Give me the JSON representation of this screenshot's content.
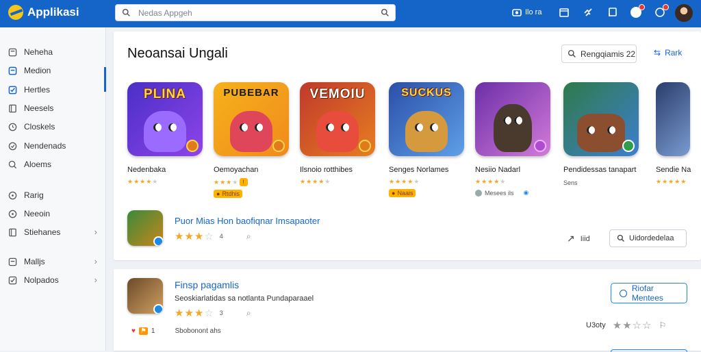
{
  "app": {
    "title": "Applikasi"
  },
  "search": {
    "placeholder": "Nedas Appgeh"
  },
  "topbar": {
    "notify_label": "Ilo ra"
  },
  "sidebar": {
    "items": [
      {
        "label": "Neheha",
        "icon": "box-icon"
      },
      {
        "label": "Medion",
        "icon": "image-icon"
      },
      {
        "label": "Hertles",
        "icon": "check-square-icon"
      },
      {
        "label": "Neesels",
        "icon": "book-icon"
      },
      {
        "label": "Closkels",
        "icon": "circle-clock-icon"
      },
      {
        "label": "Nendenads",
        "icon": "circle-check-icon"
      },
      {
        "label": "Aloems",
        "icon": "search-circle-icon"
      }
    ],
    "items2": [
      {
        "label": "Rarig",
        "icon": "circle-icon"
      },
      {
        "label": "Neeoin",
        "icon": "circle-icon"
      },
      {
        "label": "Stiehanes",
        "icon": "book-icon",
        "chevron": true
      }
    ],
    "items3": [
      {
        "label": "Malljs",
        "icon": "image-icon",
        "chevron": true
      },
      {
        "label": "Nolpados",
        "icon": "check-square-icon",
        "chevron": true
      }
    ]
  },
  "main": {
    "section_title": "Neoansai Ungali",
    "filter_label": "Rengqiamis 22",
    "more_label": "Rark",
    "apps": [
      {
        "title": "PLINA",
        "name": "Nedenbaka",
        "stars": 4
      },
      {
        "title": "PUBEBAR",
        "name": "Oemoyachan",
        "stars": 3,
        "tag": "Rtdhis"
      },
      {
        "title": "VEMOIU",
        "name": "Ilsnoio rotthibes",
        "stars": 4
      },
      {
        "title": "SUCKUS",
        "name": "Senges Norlames",
        "stars": 4,
        "tag": "Naais"
      },
      {
        "title": "",
        "name": "Nesiio Nadarl",
        "stars": 4,
        "extra": "Mesees ils"
      },
      {
        "title": "",
        "name": "Pendidessas tanapart",
        "extra": "Sens"
      },
      {
        "title": "",
        "name": "Sendie Nantinl",
        "stars": 5
      }
    ],
    "featured": {
      "title": "Puor Mias Hon baofiqnar Imsapaoter",
      "stars": "4",
      "share_label": "Iiid",
      "search_button": "Uidordedelaa"
    }
  },
  "second": {
    "title": "Finsp pagamlis",
    "subtitle": "Seoskiarlatidas sa notlanta Pundaparaael",
    "stars": "3",
    "meta": "Sbobonont ahs",
    "count": "1",
    "button": "Riofar Mentees",
    "rating_label": "U3oty"
  },
  "colors": {
    "brand": "#1565c8",
    "star": "#f5a623"
  }
}
